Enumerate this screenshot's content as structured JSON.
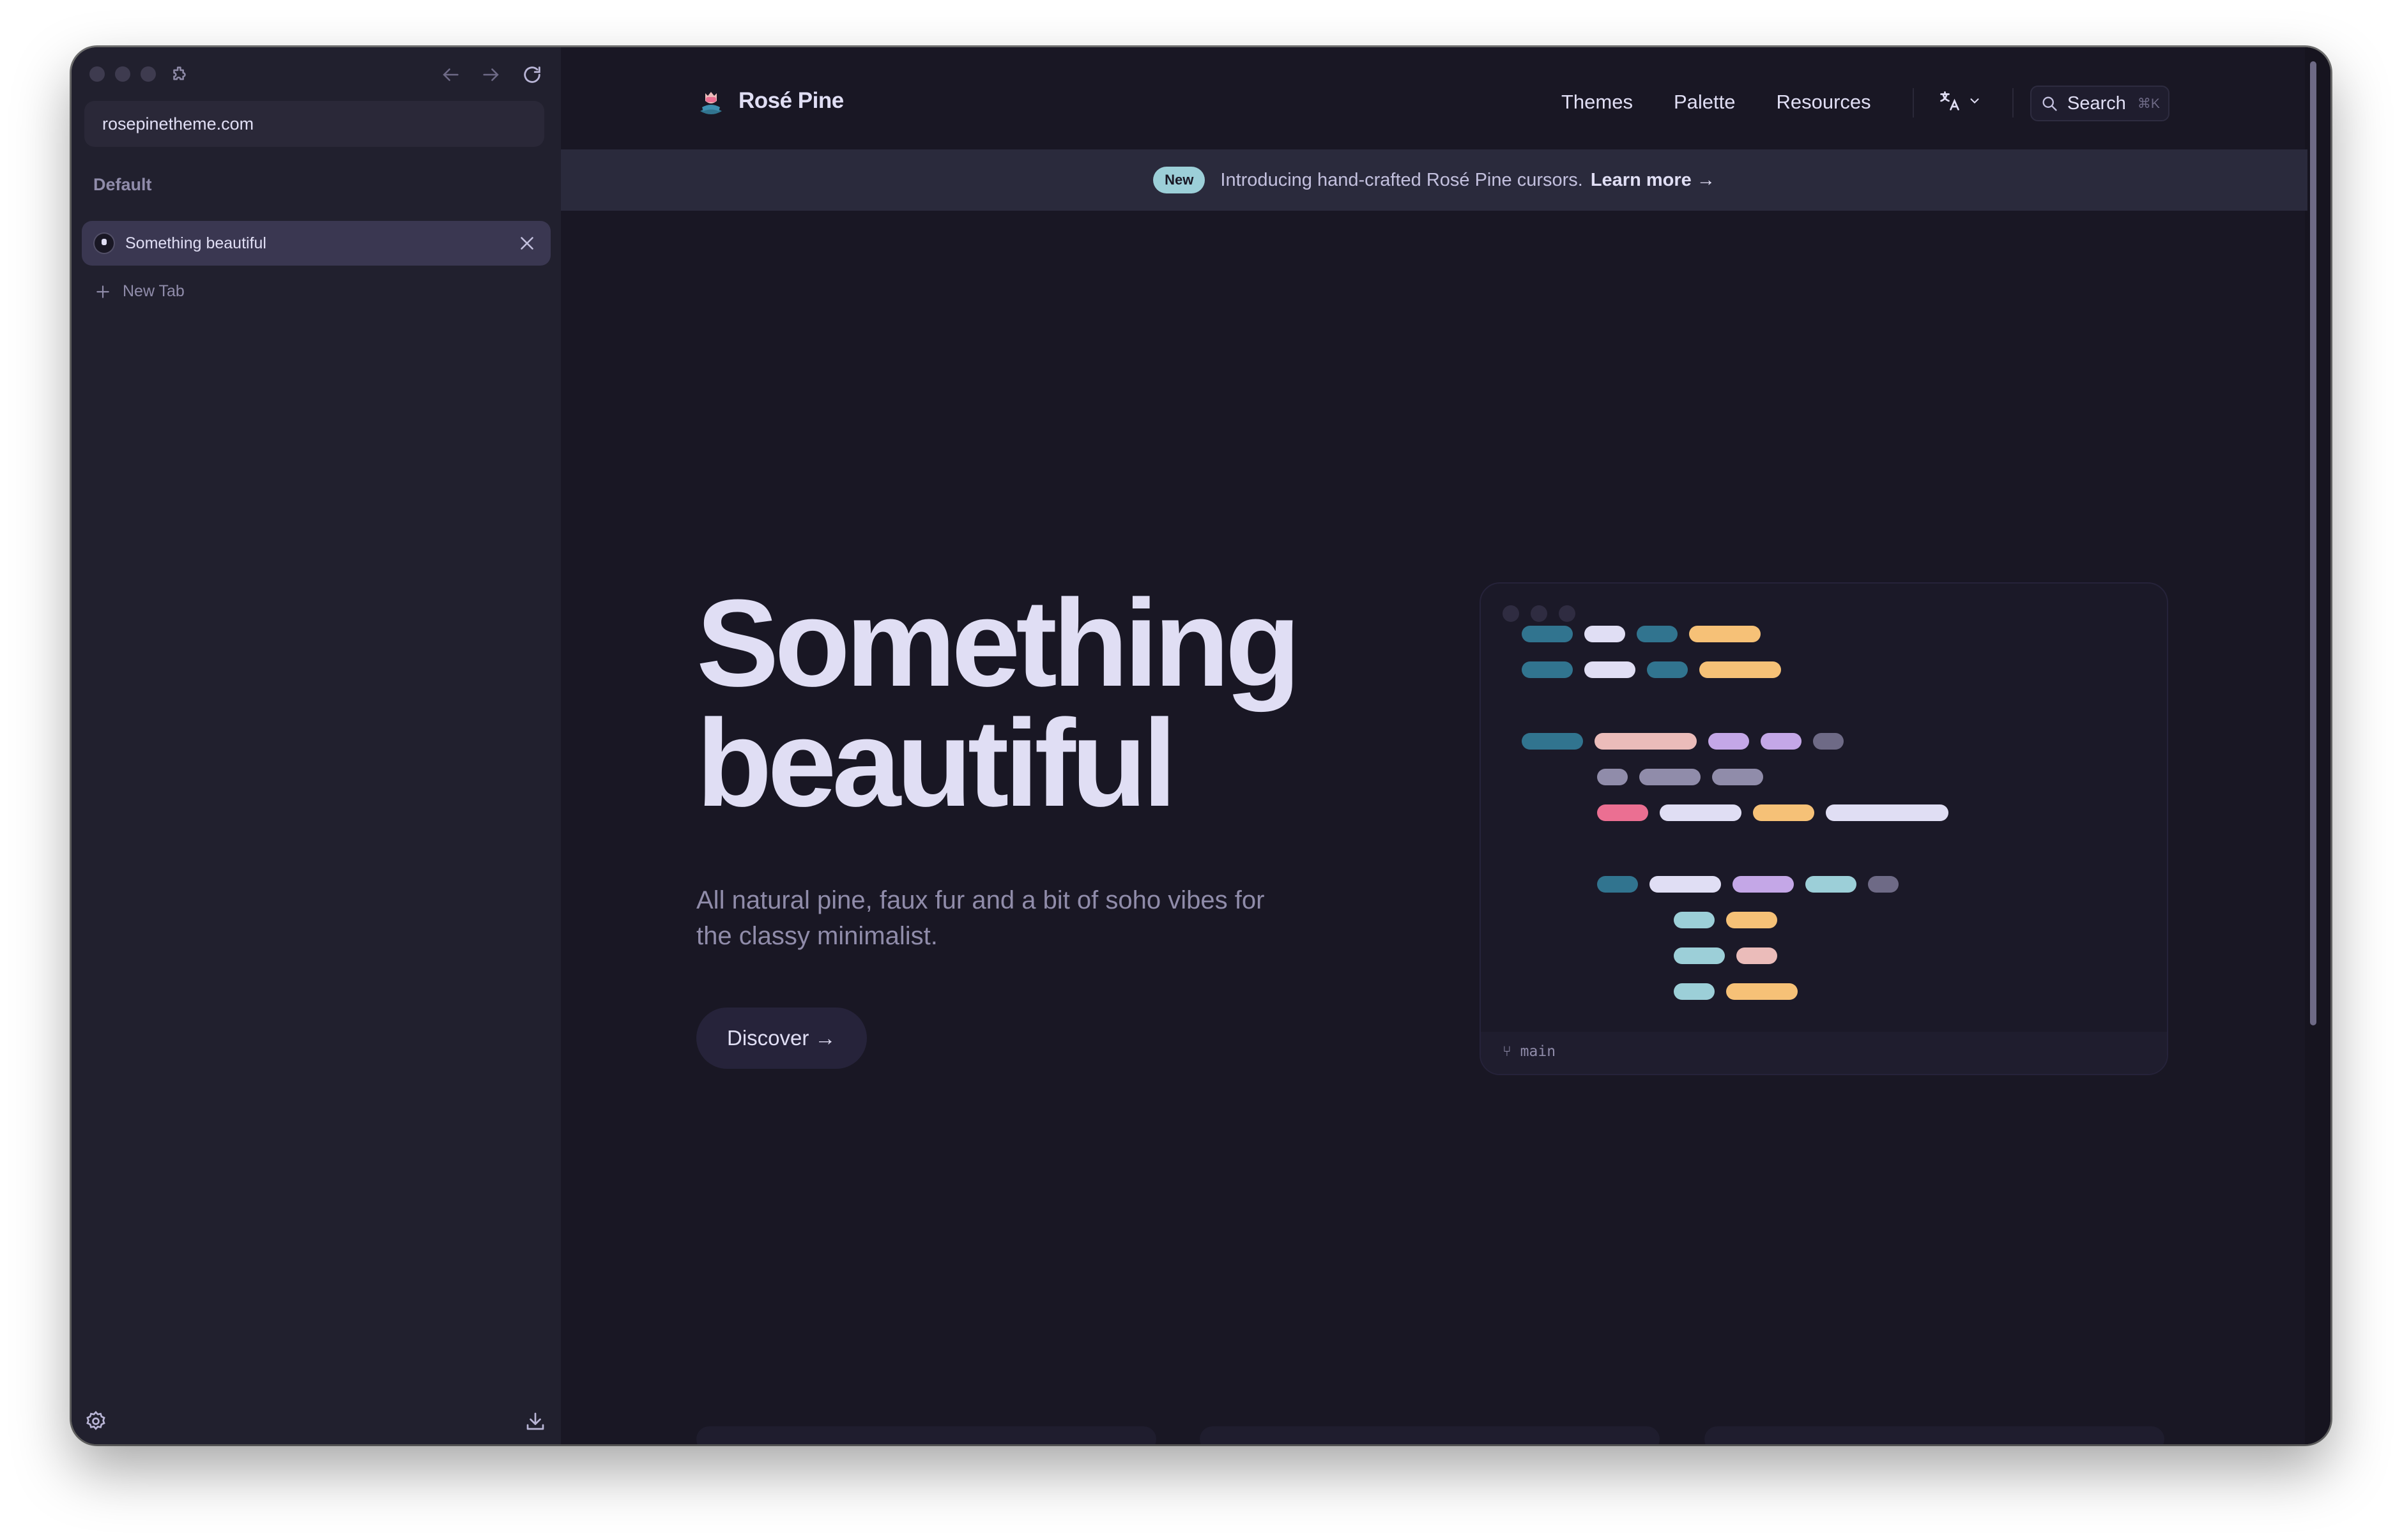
{
  "browser": {
    "url": "rosepinetheme.com",
    "space_label": "Default",
    "active_tab": "Something beautiful",
    "new_tab_label": "New Tab"
  },
  "nav": {
    "logo_text": "Rosé Pine",
    "links": [
      "Themes",
      "Palette",
      "Resources"
    ],
    "search_label": "Search",
    "search_shortcut": "⌘K"
  },
  "banner": {
    "badge": "New",
    "text": "Introducing hand-crafted Rosé Pine cursors.",
    "link": "Learn more →"
  },
  "hero": {
    "title_line1": "Something",
    "title_line2": "beautiful",
    "subtitle": "All natural pine, faux fur and a bit of soho vibes for the classy minimalist.",
    "cta": "Discover →"
  },
  "code_preview": {
    "branch": "main"
  },
  "colors": {
    "base": "#191724",
    "surface": "#1f1d2e",
    "overlay": "#26233a",
    "text": "#e0def4",
    "subtle": "#908caa",
    "muted": "#6e6a86",
    "love": "#eb6f92",
    "gold": "#f6c177",
    "rose": "#ebbcba",
    "pine": "#31748f",
    "foam": "#9ccfd8",
    "iris": "#c4a7e7"
  }
}
